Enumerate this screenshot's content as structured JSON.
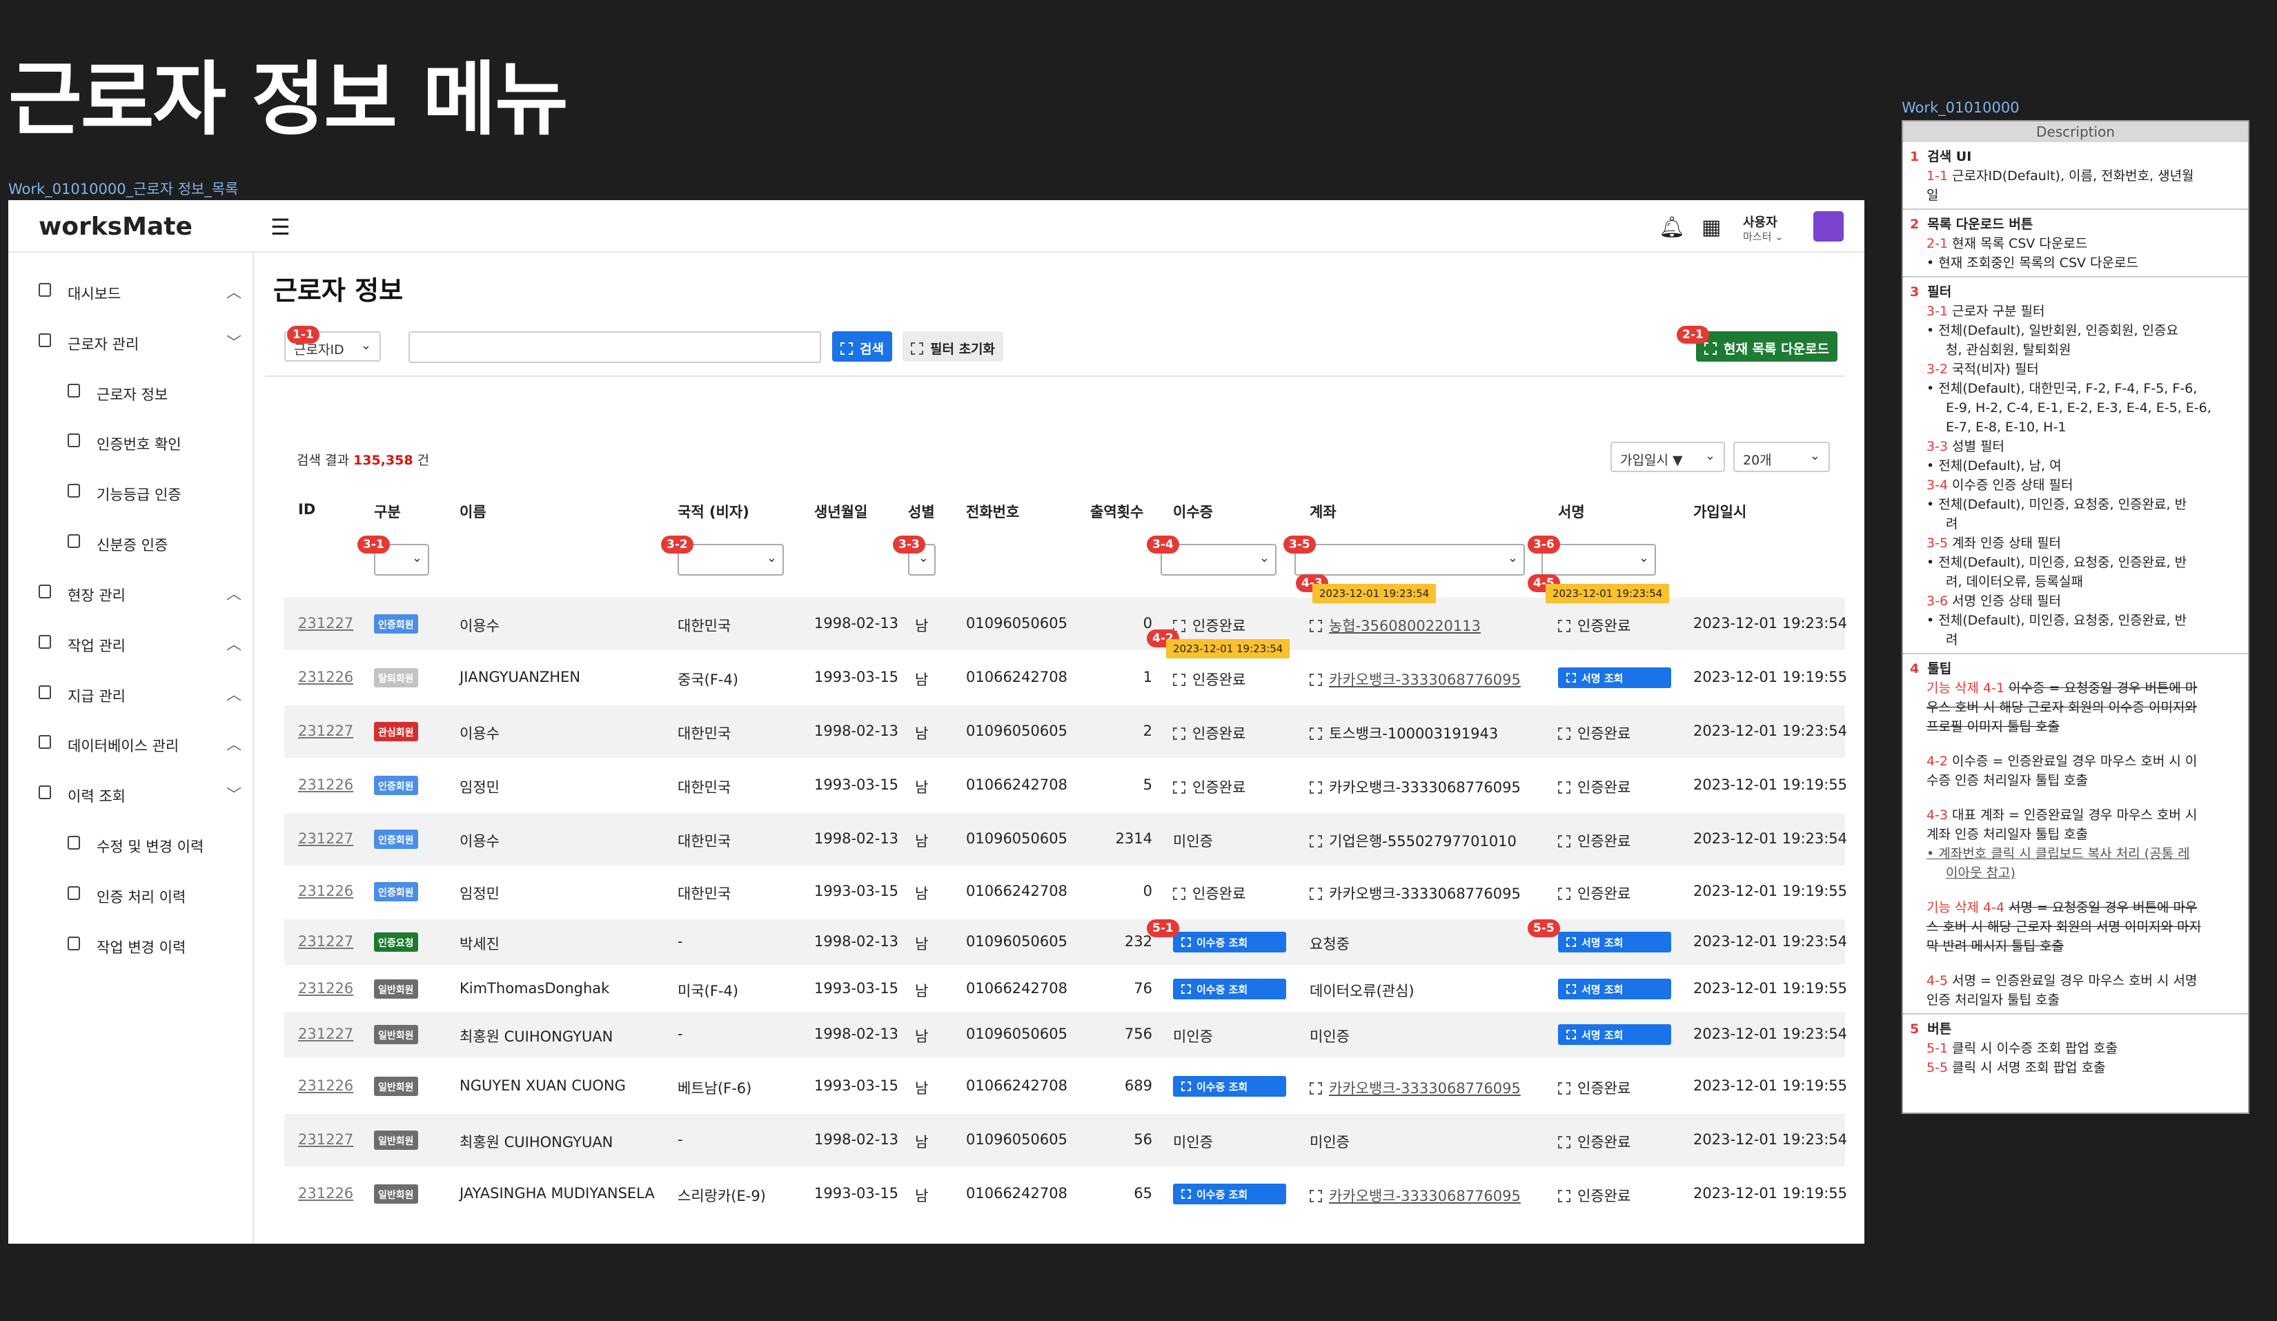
{
  "board": {
    "title": "근로자 정보 메뉴",
    "frame_label": "Work_01010000_근로자 정보_목록",
    "desc_frame_label": "Work_01010000"
  },
  "app": {
    "logo": "worksMate",
    "user": {
      "name": "사용자",
      "role": "마스터"
    },
    "sidebar": [
      {
        "label": "대시보드",
        "chevron": "^",
        "sub": false
      },
      {
        "label": "근로자 관리",
        "chevron": "v",
        "sub": false
      },
      {
        "label": "근로자 정보",
        "sub": true
      },
      {
        "label": "인증번호 확인",
        "sub": true
      },
      {
        "label": "기능등급 인증",
        "sub": true
      },
      {
        "label": "신분증 인증",
        "sub": true
      },
      {
        "label": "현장 관리",
        "chevron": "^",
        "sub": false
      },
      {
        "label": "작업 관리",
        "chevron": "^",
        "sub": false
      },
      {
        "label": "지급 관리",
        "chevron": "^",
        "sub": false
      },
      {
        "label": "데이터베이스 관리",
        "chevron": "^",
        "sub": false
      },
      {
        "label": "이력 조회",
        "chevron": "v",
        "sub": false
      },
      {
        "label": "수정 및 변경 이력",
        "sub": true
      },
      {
        "label": "인증 처리 이력",
        "sub": true
      },
      {
        "label": "작업 변경 이력",
        "sub": true
      }
    ],
    "page_title": "근로자 정보",
    "search": {
      "field_select": "근로자ID",
      "search_button": "검색",
      "reset_button": "필터 초기화",
      "download_button": "현재 목록 다운로드"
    },
    "result": {
      "prefix": "검색 결과",
      "count": "135,358",
      "suffix": "건"
    },
    "sort_select": "가입일시 ▼",
    "page_size_select": "20개",
    "columns": [
      "ID",
      "구분",
      "이름",
      "국적 (비자)",
      "생년월일",
      "성별",
      "전화번호",
      "출역횟수",
      "이수증",
      "계좌",
      "서명",
      "가입일시"
    ],
    "rows": [
      {
        "id": "231227",
        "type": "인증회원",
        "type_color": "#4a8ee8",
        "name": "이용수",
        "nation": "대한민국",
        "birth": "1998-02-13",
        "sex": "남",
        "phone": "01096050605",
        "count": "0",
        "cert": {
          "kind": "done",
          "text": "인증완료"
        },
        "account": {
          "kind": "link",
          "text": "농협-3560800220113"
        },
        "sign": {
          "kind": "done",
          "text": "인증완료"
        },
        "joined": "2023-12-01 19:23:54"
      },
      {
        "id": "231226",
        "type": "탈퇴회원",
        "type_color": "#c3c3c3",
        "name": "JIANGYUANZHEN",
        "nation": "중국(F-4)",
        "birth": "1993-03-15",
        "sex": "남",
        "phone": "01066242708",
        "count": "1",
        "cert": {
          "kind": "done",
          "text": "인증완료"
        },
        "account": {
          "kind": "link",
          "text": "카카오뱅크-3333068776095"
        },
        "sign": {
          "kind": "button",
          "text": "서명 조회"
        },
        "joined": "2023-12-01 19:19:55"
      },
      {
        "id": "231227",
        "type": "관심회원",
        "type_color": "#d32f2f",
        "name": "이용수",
        "nation": "대한민국",
        "birth": "1998-02-13",
        "sex": "남",
        "phone": "01096050605",
        "count": "2",
        "cert": {
          "kind": "done",
          "text": "인증완료"
        },
        "account": {
          "kind": "done",
          "text": "토스뱅크-100003191943"
        },
        "sign": {
          "kind": "done",
          "text": "인증완료"
        },
        "joined": "2023-12-01 19:23:54"
      },
      {
        "id": "231226",
        "type": "인증회원",
        "type_color": "#4a8ee8",
        "name": "임정민",
        "nation": "대한민국",
        "birth": "1993-03-15",
        "sex": "남",
        "phone": "01066242708",
        "count": "5",
        "cert": {
          "kind": "done",
          "text": "인증완료"
        },
        "account": {
          "kind": "done",
          "text": "카카오뱅크-3333068776095"
        },
        "sign": {
          "kind": "done",
          "text": "인증완료"
        },
        "joined": "2023-12-01 19:19:55"
      },
      {
        "id": "231227",
        "type": "인증회원",
        "type_color": "#4a8ee8",
        "name": "이용수",
        "nation": "대한민국",
        "birth": "1998-02-13",
        "sex": "남",
        "phone": "01096050605",
        "count": "2314",
        "cert": {
          "kind": "plain",
          "text": "미인증"
        },
        "account": {
          "kind": "done",
          "text": "기업은행-55502797701010"
        },
        "sign": {
          "kind": "done",
          "text": "인증완료"
        },
        "joined": "2023-12-01 19:23:54"
      },
      {
        "id": "231226",
        "type": "인증회원",
        "type_color": "#4a8ee8",
        "name": "임정민",
        "nation": "대한민국",
        "birth": "1993-03-15",
        "sex": "남",
        "phone": "01066242708",
        "count": "0",
        "cert": {
          "kind": "done",
          "text": "인증완료"
        },
        "account": {
          "kind": "done",
          "text": "카카오뱅크-3333068776095"
        },
        "sign": {
          "kind": "done",
          "text": "인증완료"
        },
        "joined": "2023-12-01 19:19:55"
      },
      {
        "id": "231227",
        "type": "인증요청",
        "type_color": "#1b7a2e",
        "name": "박세진",
        "nation": "-",
        "birth": "1998-02-13",
        "sex": "남",
        "phone": "01096050605",
        "count": "232",
        "cert": {
          "kind": "button",
          "text": "이수증 조회"
        },
        "account": {
          "kind": "plain",
          "text": "요청중"
        },
        "sign": {
          "kind": "button",
          "text": "서명 조회"
        },
        "joined": "2023-12-01 19:23:54"
      },
      {
        "id": "231226",
        "type": "일반회원",
        "type_color": "#6d6d6d",
        "name": "KimThomasDonghak",
        "nation": "미국(F-4)",
        "birth": "1993-03-15",
        "sex": "남",
        "phone": "01066242708",
        "count": "76",
        "cert": {
          "kind": "button",
          "text": "이수증 조회"
        },
        "account": {
          "kind": "plain",
          "text": "데이터오류(관심)"
        },
        "sign": {
          "kind": "button",
          "text": "서명 조회"
        },
        "joined": "2023-12-01 19:19:55"
      },
      {
        "id": "231227",
        "type": "일반회원",
        "type_color": "#6d6d6d",
        "name": "최홍원 CUIHONGYUAN",
        "nation": "-",
        "birth": "1998-02-13",
        "sex": "남",
        "phone": "01096050605",
        "count": "756",
        "cert": {
          "kind": "plain",
          "text": "미인증"
        },
        "account": {
          "kind": "plain",
          "text": "미인증"
        },
        "sign": {
          "kind": "button",
          "text": "서명 조회"
        },
        "joined": "2023-12-01 19:23:54"
      },
      {
        "id": "231226",
        "type": "일반회원",
        "type_color": "#6d6d6d",
        "name": "NGUYEN XUAN CUONG",
        "nation": "베트남(F-6)",
        "birth": "1993-03-15",
        "sex": "남",
        "phone": "01066242708",
        "count": "689",
        "cert": {
          "kind": "button",
          "text": "이수증 조회"
        },
        "account": {
          "kind": "link",
          "text": "카카오뱅크-3333068776095"
        },
        "sign": {
          "kind": "done",
          "text": "인증완료"
        },
        "joined": "2023-12-01 19:19:55"
      },
      {
        "id": "231227",
        "type": "일반회원",
        "type_color": "#6d6d6d",
        "name": "최홍원 CUIHONGYUAN",
        "nation": "-",
        "birth": "1998-02-13",
        "sex": "남",
        "phone": "01096050605",
        "count": "56",
        "cert": {
          "kind": "plain",
          "text": "미인증"
        },
        "account": {
          "kind": "plain",
          "text": "미인증"
        },
        "sign": {
          "kind": "done",
          "text": "인증완료"
        },
        "joined": "2023-12-01 19:23:54"
      },
      {
        "id": "231226",
        "type": "일반회원",
        "type_color": "#6d6d6d",
        "name": "JAYASINGHA MUDIYANSELA",
        "nation": "스리랑카(E-9)",
        "birth": "1993-03-15",
        "sex": "남",
        "phone": "01066242708",
        "count": "65",
        "cert": {
          "kind": "button",
          "text": "이수증 조회"
        },
        "account": {
          "kind": "link",
          "text": "카카오뱅크-3333068776095"
        },
        "sign": {
          "kind": "done",
          "text": "인증완료"
        },
        "joined": "2023-12-01 19:19:55"
      }
    ],
    "tooltip_time": "2023-12-01 19:23:54",
    "badges": {
      "b1_1": "1-1",
      "b2_1": "2-1",
      "b3_1": "3-1",
      "b3_2": "3-2",
      "b3_3": "3-3",
      "b3_4": "3-4",
      "b3_5": "3-5",
      "b3_6": "3-6",
      "b4_2": "4-2",
      "b4_3": "4-3",
      "b4_5": "4-5",
      "b5_1": "5-1",
      "b5_5": "5-5"
    }
  },
  "description": {
    "header": "Description",
    "lines": [
      {
        "num": "1",
        "text": "검색 UI",
        "kind": "head"
      },
      {
        "num": "1-1",
        "text": "근로자ID(Default), 이름, 전화번호, 생년월",
        "kind": "sub"
      },
      {
        "text": "일",
        "kind": "cont"
      },
      {
        "num": "2",
        "text": "목록 다운로드 버튼",
        "kind": "head"
      },
      {
        "num": "2-1",
        "text": "현재 목록 CSV 다운로드",
        "kind": "sub"
      },
      {
        "text": "• 현재 조회중인 목록의 CSV 다운로드",
        "kind": "bullet"
      },
      {
        "num": "3",
        "text": "필터",
        "kind": "head"
      },
      {
        "num": "3-1",
        "text": "근로자 구분 필터",
        "kind": "sub"
      },
      {
        "text": "• 전체(Default), 일반회원, 인증회원, 인증요",
        "kind": "bullet"
      },
      {
        "text": "청, 관심회원, 탈퇴회원",
        "kind": "cont2"
      },
      {
        "num": "3-2",
        "text": "국적(비자) 필터",
        "kind": "sub"
      },
      {
        "text": "• 전체(Default), 대한민국, F-2, F-4, F-5, F-6,",
        "kind": "bullet"
      },
      {
        "text": "E-9, H-2, C-4, E-1, E-2, E-3, E-4, E-5, E-6,",
        "kind": "cont2"
      },
      {
        "text": "E-7, E-8, E-10, H-1",
        "kind": "cont2"
      },
      {
        "num": "3-3",
        "text": "성별 필터",
        "kind": "sub"
      },
      {
        "text": "• 전체(Default), 남, 여",
        "kind": "bullet"
      },
      {
        "num": "3-4",
        "text": "이수증 인증 상태 필터",
        "kind": "sub"
      },
      {
        "text": "• 전체(Default), 미인증, 요청중, 인증완료, 반",
        "kind": "bullet"
      },
      {
        "text": "려",
        "kind": "cont2"
      },
      {
        "num": "3-5",
        "text": "계좌 인증 상태 필터",
        "kind": "sub"
      },
      {
        "text": "• 전체(Default), 미인증, 요청중, 인증완료, 반",
        "kind": "bullet"
      },
      {
        "text": "려, 데이터오류, 등록실패",
        "kind": "cont2"
      },
      {
        "num": "3-6",
        "text": "서명 인증 상태 필터",
        "kind": "sub"
      },
      {
        "text": "• 전체(Default), 미인증, 요청중, 인증완료, 반",
        "kind": "bullet"
      },
      {
        "text": "려",
        "kind": "cont2"
      },
      {
        "num": "4",
        "text": "툴팁",
        "kind": "head"
      },
      {
        "num": "기능 삭제 4-1",
        "text": "이수증 = 요청중일 경우 버튼에 마",
        "kind": "strike"
      },
      {
        "text": "우스 호버 시 해당 근로자 회원의 이수증 이미지와",
        "kind": "strikecont"
      },
      {
        "text": "프로필 이미지 툴팁 호출",
        "kind": "strikecont"
      },
      {
        "num": "4-2",
        "text": "이수증 = 인증완료일 경우 마우스 호버 시 이",
        "kind": "sub"
      },
      {
        "text": "수증 인증 처리일자 툴팁 호출",
        "kind": "cont"
      },
      {
        "num": "4-3",
        "text": "대표 계좌 = 인증완료일 경우 마우스 호버 시",
        "kind": "sub"
      },
      {
        "text": "계좌 인증 처리일자 툴팁 호출",
        "kind": "cont"
      },
      {
        "text": "• 계좌번호 클릭 시 클립보드 복사 처리 (공통 레",
        "kind": "bulletul"
      },
      {
        "text": "이아웃 참고)",
        "kind": "cont2ul"
      },
      {
        "num": "기능 삭제 4-4",
        "text": "서명 = 요청중일 경우 버튼에 마우",
        "kind": "strike"
      },
      {
        "text": "스 호버 시 해당 근로자 회원의 서명 이미지와 마지",
        "kind": "strikecont"
      },
      {
        "text": "막 반려 메시지 툴팁 호출",
        "kind": "strikecont"
      },
      {
        "num": "4-5",
        "text": "서명 = 인증완료일 경우 마우스 호버 시 서명",
        "kind": "sub"
      },
      {
        "text": "인증 처리일자 툴팁 호출",
        "kind": "cont"
      },
      {
        "num": "5",
        "text": "버튼",
        "kind": "head"
      },
      {
        "num": "5-1",
        "text": "클릭 시 이수증 조회 팝업 호출",
        "kind": "sub"
      },
      {
        "num": "5-5",
        "text": "클릭 시 서명 조회 팝업 호출",
        "kind": "sub"
      }
    ]
  }
}
